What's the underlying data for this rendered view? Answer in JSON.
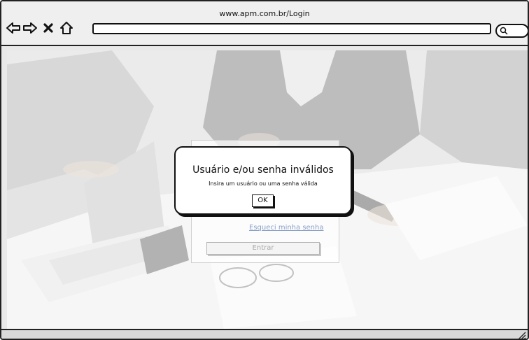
{
  "browser": {
    "url": "www.apm.com.br/Login"
  },
  "icons": {
    "back": "arrow-left-icon",
    "forward": "arrow-right-icon",
    "close": "close-icon",
    "home": "home-icon",
    "search": "search-icon",
    "resize": "resize-grip-icon"
  },
  "login": {
    "forgot_password": "Esqueci minha senha",
    "submit_label": "Entrar"
  },
  "dialog": {
    "title": "Usuário e/ou senha inválidos",
    "message": "Insira um usuário ou uma senha válida",
    "ok_label": "OK"
  }
}
